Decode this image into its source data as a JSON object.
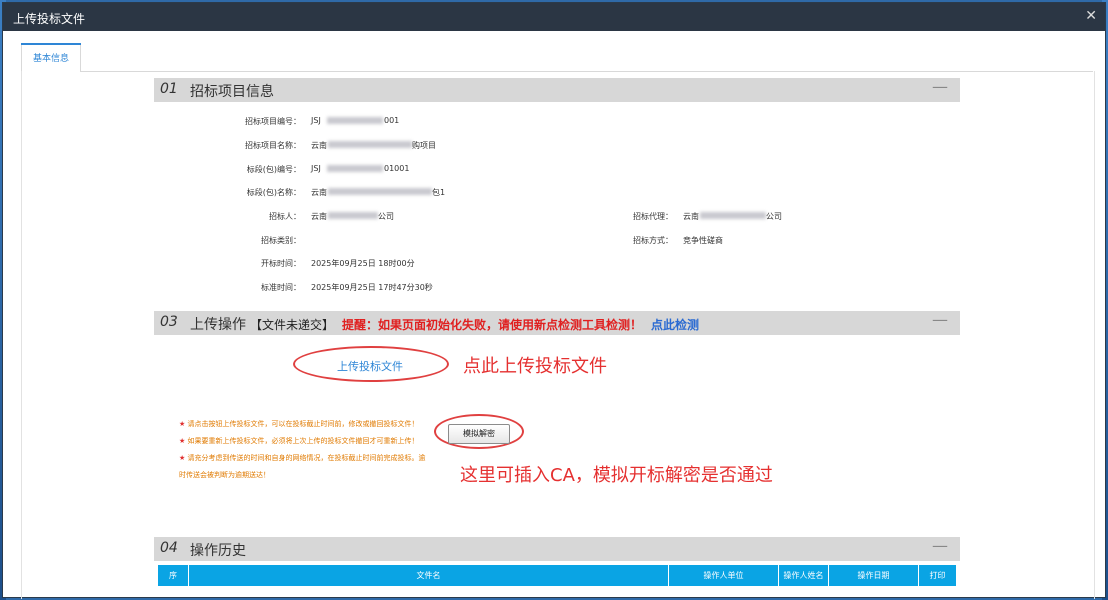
{
  "window": {
    "title": "上传投标文件",
    "close_icon": "close-icon"
  },
  "tabs": [
    {
      "label": "基本信息"
    }
  ],
  "section1": {
    "num": "01",
    "title": "招标项目信息",
    "collapse": "—",
    "fields": {
      "project_no": {
        "label": "招标项目编号：",
        "value_start": "JSJ",
        "value_end": "001"
      },
      "project_name": {
        "label": "招标项目名称：",
        "value_start": "云南",
        "value_end": "购项目"
      },
      "lot_no": {
        "label": "标段(包)编号：",
        "value_start": "JSJ",
        "value_end": "01001"
      },
      "lot_name": {
        "label": "标段(包)名称：",
        "value_start": "云南",
        "value_end": "包1"
      },
      "tenderer": {
        "label": "招标人：",
        "value_start": "云南",
        "value_end": "公司"
      },
      "agent": {
        "label": "招标代理：",
        "value_start": "云南",
        "value_end": "公司"
      },
      "category": {
        "label": "招标类别：",
        "value": ""
      },
      "method": {
        "label": "招标方式：",
        "value": "竞争性磋商"
      },
      "open_time": {
        "label": "开标时间：",
        "value": "2025年09月25日 18时00分"
      },
      "std_time": {
        "label": "标准时间：",
        "value": "2025年09月25日 17时47分30秒"
      }
    }
  },
  "section3": {
    "num": "03",
    "title": "上传操作",
    "status": "【文件未递交】",
    "notice": "提醒：如果页面初始化失败，请使用新点检测工具检测！",
    "detect_link": "点此检测",
    "collapse": "—",
    "upload_button": "上传投标文件",
    "upload_annotation": "点此上传投标文件",
    "simulate_button": "模拟解密",
    "simulate_annotation": "这里可插入CA，模拟开标解密是否通过",
    "hints": [
      {
        "star": "★",
        "text": " 请点击按钮上传投标文件，可以在投标截止时间前，修改或撤回投标文件！"
      },
      {
        "star": "★",
        "text": " 如果要重新上传投标文件，必须将上次上传的投标文件撤回才可重新上传！"
      },
      {
        "star": "★",
        "text": " 请充分考虑到传送的时间和自身的网络情况，在投标截止时间前完成投标。逾时传送会被判断为逾期送达！"
      }
    ]
  },
  "section4": {
    "num": "04",
    "title": "操作历史",
    "collapse": "—",
    "columns": [
      "序",
      "文件名",
      "操作人单位",
      "操作人姓名",
      "操作日期",
      "打印"
    ]
  },
  "colors": {
    "accent": "#2e86d6",
    "header_bg": "#0aa4e4",
    "alert": "#e02020",
    "hint": "#e07a00"
  }
}
